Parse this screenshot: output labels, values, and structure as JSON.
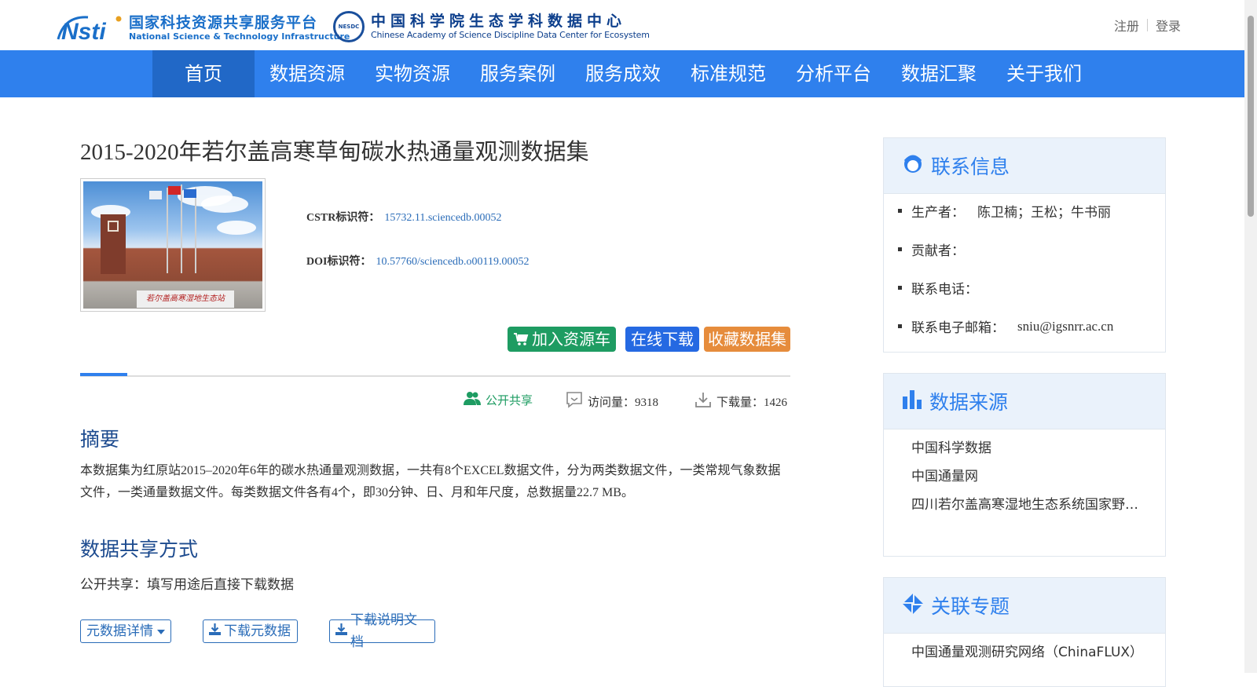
{
  "header": {
    "logo1_cn": "国家科技资源共享服务平台",
    "logo1_en": "National Science & Technology Infrastructure",
    "logo1_mark": "Nsti",
    "logo2_seal": "NESDC",
    "logo2_cn": "中国科学院生态学科数据中心",
    "logo2_en": "Chinese Academy of Science Discipline Data Center for Ecosystem",
    "register": "注册",
    "login": "登录"
  },
  "nav": {
    "items": [
      {
        "label": "首页"
      },
      {
        "label": "数据资源"
      },
      {
        "label": "实物资源"
      },
      {
        "label": "服务案例"
      },
      {
        "label": "服务成效"
      },
      {
        "label": "标准规范"
      },
      {
        "label": "分析平台"
      },
      {
        "label": "数据汇聚"
      },
      {
        "label": "关于我们"
      }
    ]
  },
  "dataset": {
    "title": "2015-2020年若尔盖高寒草甸碳水热通量观测数据集",
    "thumbnail_plaque": "若尔盖高寒湿地生态站",
    "cstr_label": "CSTR标识符：",
    "cstr_value": "15732.11.sciencedb.00052",
    "doi_label": "DOI标识符：",
    "doi_value": "10.57760/sciencedb.o00119.00052"
  },
  "actions": {
    "cart": "加入资源车",
    "download": "在线下载",
    "favorite": "收藏数据集"
  },
  "stats": {
    "share": "公开共享",
    "visits": "访问量：9318",
    "downloads": "下载量：1426"
  },
  "abstract": {
    "heading": "摘要",
    "text": "本数据集为红原站2015–2020年6年的碳水热通量观测数据，一共有8个EXCEL数据文件，分为两类数据文件，一类常规气象数据文件，一类通量数据文件。每类数据文件各有4个，即30分钟、日、月和年尺度，总数据量22.7 MB。"
  },
  "sharing": {
    "heading": "数据共享方式",
    "text": "公开共享：填写用途后直接下载数据"
  },
  "bottom_buttons": {
    "metadata_detail": "元数据详情",
    "download_metadata": "下载元数据",
    "download_doc": "下载说明文档"
  },
  "contact": {
    "title": "联系信息",
    "rows": [
      {
        "label": "生产者：",
        "value": "陈卫楠；王松；牛书丽"
      },
      {
        "label": "贡献者：",
        "value": ""
      },
      {
        "label": "联系电话：",
        "value": ""
      },
      {
        "label": "联系电子邮箱：",
        "value": "sniu@igsnrr.ac.cn"
      }
    ]
  },
  "sources": {
    "title": "数据来源",
    "items": [
      "中国科学数据",
      "中国通量网",
      "四川若尔盖高寒湿地生态系统国家野外科学观测研究站"
    ]
  },
  "topics": {
    "title": "关联专题",
    "items": [
      "中国通量观测研究网络（ChinaFLUX）"
    ]
  },
  "colors": {
    "nav_bg": "#2f80ed",
    "nav_active": "#2168c7",
    "cart_green": "#1e9c62",
    "download_blue": "#2569e2",
    "favorite_orange": "#e68c3c",
    "heading_blue": "#1d4b8f"
  }
}
